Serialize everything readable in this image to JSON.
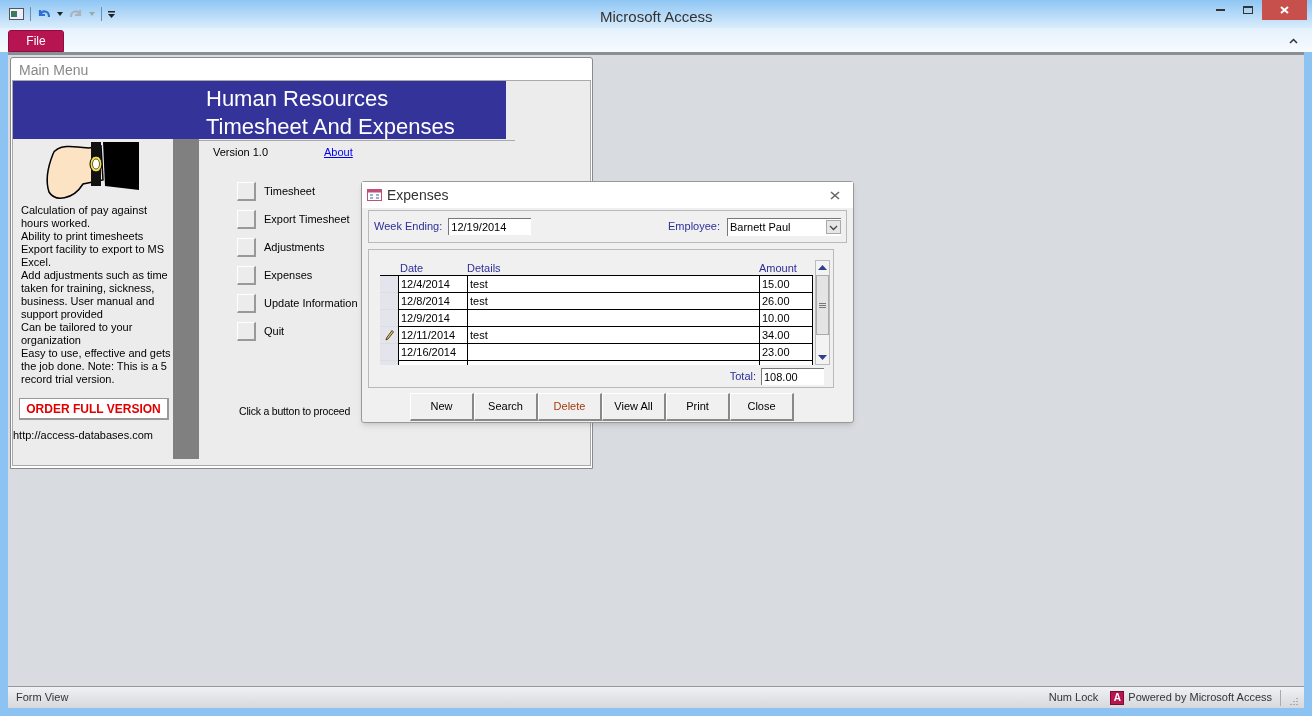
{
  "app": {
    "title": "Microsoft Access",
    "file_tab": "File"
  },
  "main_menu": {
    "title": "Main Menu",
    "banner_title": "Human Resources",
    "banner_subtitle": "Timesheet And Expenses",
    "version": "Version 1.0",
    "about_link": "About",
    "features": [
      "Calculation of pay against hours worked.",
      "Ability to print timesheets",
      "Export facility to export to MS Excel.",
      "Add adjustments such as time taken for training, sickness, business. User manual and support provided",
      "Can be tailored to your organization",
      "Easy to use, effective and gets the job done. Note: This is a 5 record trial version."
    ],
    "order_button": "ORDER FULL VERSION",
    "website": "http://access-databases.com",
    "menu_items": [
      "Timesheet",
      "Export Timesheet",
      "Adjustments",
      "Expenses",
      "Update Information",
      "Quit"
    ],
    "prompt": "Click a button to proceed"
  },
  "expenses": {
    "title": "Expenses",
    "week_ending_label": "Week Ending:",
    "week_ending": "12/19/2014",
    "employee_label": "Employee:",
    "employee": "Barnett Paul",
    "columns": [
      "Date",
      "Details",
      "Amount"
    ],
    "rows": [
      {
        "date": "12/4/2014",
        "details": "test",
        "amount": "15.00",
        "editing": false
      },
      {
        "date": "12/8/2014",
        "details": "test",
        "amount": "26.00",
        "editing": false
      },
      {
        "date": "12/9/2014",
        "details": "",
        "amount": "10.00",
        "editing": false
      },
      {
        "date": "12/11/2014",
        "details": "test",
        "amount": "34.00",
        "editing": true
      },
      {
        "date": "12/16/2014",
        "details": "",
        "amount": "23.00",
        "editing": false
      }
    ],
    "total_label": "Total:",
    "total": "108.00",
    "buttons": [
      {
        "label": "New",
        "kind": "normal"
      },
      {
        "label": "Search",
        "kind": "normal"
      },
      {
        "label": "Delete",
        "kind": "danger"
      },
      {
        "label": "View All",
        "kind": "normal"
      },
      {
        "label": "Print",
        "kind": "normal"
      },
      {
        "label": "Close",
        "kind": "normal"
      }
    ]
  },
  "status_bar": {
    "view": "Form View",
    "num_lock": "Num Lock",
    "logo_letter": "A",
    "powered_by": "Powered by Microsoft Access"
  }
}
